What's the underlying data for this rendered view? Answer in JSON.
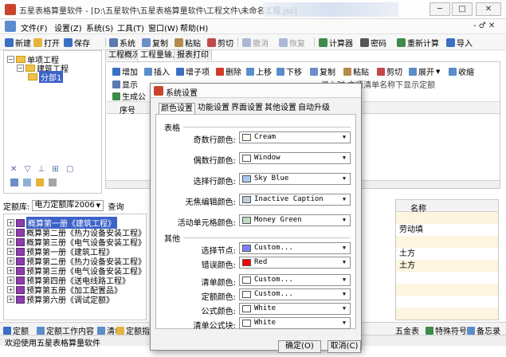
{
  "titlebar": {
    "title": "五星表格算量软件 - [D:\\五星软件\\五星表格算量软件\\工程文件\\未命名工程.jss]",
    "minimize": "─",
    "maximize": "□",
    "close": "✕"
  },
  "menubar": {
    "items": [
      "文件(F)",
      "设置(Z)",
      "系统(S)",
      "工具(T)",
      "窗口(W)",
      "帮助(H)"
    ],
    "right_controls": "- ♂ ✕"
  },
  "toolbar": {
    "items": [
      "新建",
      "打开",
      "保存",
      "系统",
      "复制",
      "粘贴",
      "剪切",
      "撤消",
      "恢复",
      "计算器",
      "密码",
      "重新计算",
      "导入"
    ]
  },
  "left_tree": {
    "root": "单项工程",
    "child": "建筑工程",
    "leaf": "分部1",
    "icon_row": [
      "✕",
      "▽",
      "⊥",
      "⊞",
      "▢"
    ]
  },
  "right_panel": {
    "tabs": [
      "工程概况",
      "工程量输入",
      "报表打印"
    ],
    "toolbar_row1": [
      "增加",
      "插入",
      "增子项",
      "删除",
      "上移",
      "下移",
      "复制",
      "粘贴",
      "剪切",
      "展开",
      "收缩"
    ],
    "toolbar_row2": [
      "显示",
      "生成公"
    ],
    "row2_hidden": "录入时 主项清单名称下显示定额",
    "grid_header": [
      "序号"
    ]
  },
  "quota": {
    "label": "定额库:",
    "value": "电力定额库2006",
    "query_button": "查询"
  },
  "quota_tree": [
    "概算第一册《建筑工程》",
    "概算第二册《热力设备安装工程》",
    "概算第三册《电气设备安装工程》",
    "预算第一册《建筑工程》",
    "预算第二册《热力设备安装工程》",
    "预算第三册《电气设备安装工程》",
    "预算第四册《送电线路工程》",
    "预算第五册《加工配置品》",
    "预算第六册《调试定额》"
  ],
  "right_list": {
    "header": "名称",
    "rows": [
      "",
      "劳动填",
      "",
      "土方",
      "土方",
      "",
      "",
      "",
      ""
    ]
  },
  "bottom_tabs": [
    "定额",
    "定额工作内容",
    "清单",
    "定额指标",
    "五金表",
    "特殊符号",
    "备忘录"
  ],
  "status": {
    "text": "欢迎使用五星表格算量软件"
  },
  "dialog": {
    "title": "系统设置",
    "tabs": [
      "颜色设置",
      "功能设置",
      "界面设置",
      "其他设置",
      "自动升级"
    ],
    "group_table": "表格",
    "group_other": "其他",
    "table_rows": [
      {
        "label": "奇数行颜色:",
        "value": "Cream",
        "color": "#FFFBF0"
      },
      {
        "label": "偶数行颜色:",
        "value": "Window",
        "color": "#FFFFFF"
      },
      {
        "label": "选择行颜色:",
        "value": "Sky Blue",
        "color": "#A6CAF0"
      },
      {
        "label": "无焦编辑颜色:",
        "value": "Inactive Caption",
        "color": "#BFCDDB"
      },
      {
        "label": "活动单元格颜色:",
        "value": "Money Green",
        "color": "#C0DCC0"
      }
    ],
    "other_rows": [
      {
        "label": "选择节点:",
        "value": "Custom...",
        "color": "#8080FF"
      },
      {
        "label": "错误颜色:",
        "value": "Red",
        "color": "#FF0000"
      },
      {
        "label": "清单颜色:",
        "value": "Custom...",
        "color": "#FFFFFF"
      },
      {
        "label": "定额颜色:",
        "value": "Custom...",
        "color": "#FFFFFF"
      },
      {
        "label": "公式颜色:",
        "value": "White",
        "color": "#FFFFFF"
      },
      {
        "label": "清单公式块:",
        "value": "White",
        "color": "#FFFFFF"
      }
    ],
    "ok": "确定(O)",
    "cancel": "取消(C)"
  }
}
